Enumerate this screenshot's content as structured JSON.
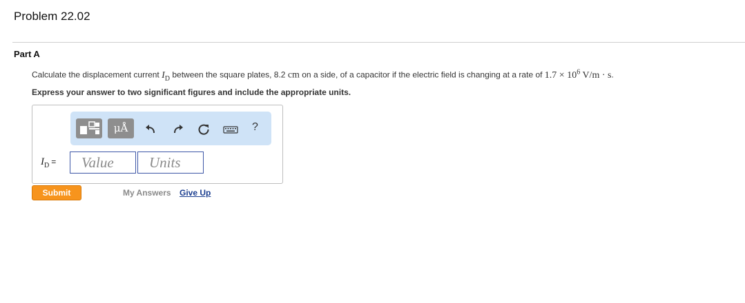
{
  "problem": {
    "title": "Problem 22.02"
  },
  "part": {
    "title": "Part A"
  },
  "question": {
    "prefix": "Calculate the displacement current ",
    "symbol": "I",
    "subscript": "D",
    "middle": " between the square plates, 8.2 ",
    "side_unit": "cm",
    "suffix": " on a side, of a capacitor if the electric field is changing at a rate of ",
    "rate_mantissa": "1.7 × 10",
    "rate_exponent": "6",
    "rate_unit": " V/m · s",
    "end": "."
  },
  "instruction": "Express your answer to two significant figures and include the appropriate units.",
  "toolbar": {
    "units_label": "μÅ",
    "help_label": "?",
    "icons": [
      "templates-icon",
      "units-icon",
      "undo-icon",
      "redo-icon",
      "reset-icon",
      "keyboard-icon",
      "help-icon"
    ]
  },
  "answer": {
    "symbol": "I",
    "subscript": "D",
    "equals": "=",
    "value_placeholder": "Value",
    "units_placeholder": "Units"
  },
  "actions": {
    "submit_label": "Submit",
    "my_answers_label": "My Answers",
    "give_up_label": "Give Up"
  },
  "colors": {
    "submit": "#f7941d",
    "toolbar_bg": "#cfe3f7",
    "link": "#1a3d8f",
    "field_border": "#3d56a6"
  }
}
